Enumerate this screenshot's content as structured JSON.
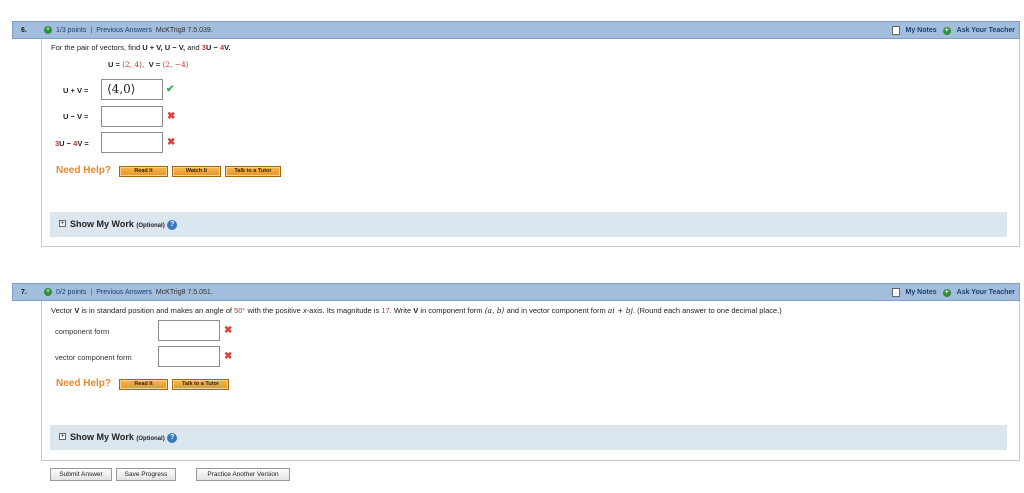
{
  "questions": [
    {
      "number": "6.",
      "points": "1/3 points",
      "separator": "|",
      "previous_answers": "Previous Answers",
      "source": "McKTrig8 7.5.039.",
      "my_notes": "My Notes",
      "ask_teacher": "Ask Your Teacher",
      "prompt_prefix": "For the pair of vectors, find ",
      "prompt_exprs": "U + V, U − V,",
      "prompt_and": " and ",
      "prompt_coef1": "3",
      "prompt_u": "U",
      "prompt_minus": " − ",
      "prompt_coef2": "4",
      "prompt_v": "V.",
      "given_u_label": "U = ",
      "given_u_value": "⟨2, 4⟩,",
      "given_v_label": "V = ",
      "given_v_value": "⟨2, −4⟩",
      "rows": [
        {
          "label": "U + V =",
          "value": "⟨4,0⟩",
          "status": "correct",
          "mark": "✔"
        },
        {
          "label": "U − V =",
          "value": "",
          "status": "incorrect",
          "mark": "✖"
        },
        {
          "coef1": "3",
          "mid": "U − ",
          "coef2": "4",
          "tail": "V =",
          "value": "",
          "status": "incorrect",
          "mark": "✖"
        }
      ],
      "need_help": "Need Help?",
      "help_buttons": [
        "Read It",
        "Watch It",
        "Talk to a Tutor"
      ],
      "show_my_work": "Show My Work",
      "optional": "(Optional)"
    },
    {
      "number": "7.",
      "points": "0/2 points",
      "separator": "|",
      "previous_answers": "Previous Answers",
      "source": "McKTrig8 7.5.051.",
      "my_notes": "My Notes",
      "ask_teacher": "Ask Your Teacher",
      "prompt_a": "Vector ",
      "prompt_v": "V",
      "prompt_b": " is in standard position and makes an angle of ",
      "prompt_angle": "50°",
      "prompt_c": " with the positive ",
      "prompt_xaxis": "x",
      "prompt_d": "-axis. Its magnitude is ",
      "prompt_mag": "17",
      "prompt_e": ". Write ",
      "prompt_v2": "V",
      "prompt_f": " in component form ",
      "prompt_ab": "⟨a, b⟩",
      "prompt_g": " and in vector component form ",
      "prompt_ai": "ai + bj",
      "prompt_h": ". (Round each answer to one decimal place.)",
      "rows": [
        {
          "label": "component form",
          "value": "",
          "status": "incorrect",
          "mark": "✖"
        },
        {
          "label": "vector component form",
          "value": "",
          "status": "incorrect",
          "mark": "✖"
        }
      ],
      "need_help": "Need Help?",
      "help_buttons": [
        "Read It",
        "Talk to a Tutor"
      ],
      "show_my_work": "Show My Work",
      "optional": "(Optional)"
    }
  ],
  "footer": {
    "submit": "Submit Answer",
    "save": "Save Progress",
    "practice": "Practice Another Version"
  },
  "icons": {
    "plus": "+",
    "expand": "+",
    "help": "?"
  },
  "colors": {
    "header_bar": "#a3bedc",
    "need_help": "#e8892a",
    "correct": "#3aa64a",
    "incorrect": "#e0403a",
    "highlight_red": "#c0392b"
  }
}
